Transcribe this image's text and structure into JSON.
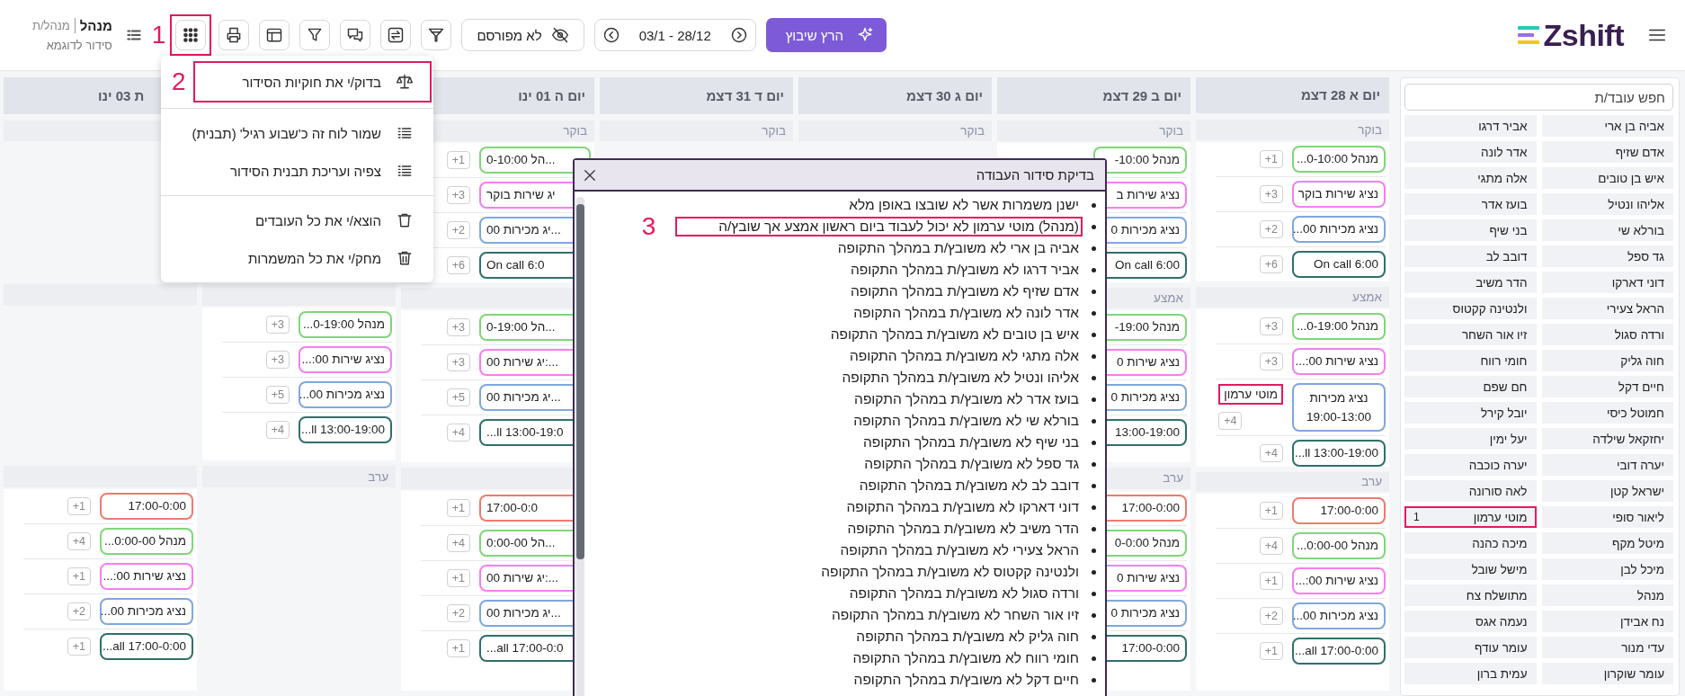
{
  "topbar": {
    "user": {
      "name": "מנהל",
      "role": "מנהל/ת",
      "schedule": "סידור לדוגמא"
    },
    "tools": [
      {
        "kind": "grid",
        "annotation": "1"
      },
      {
        "kind": "print"
      },
      {
        "kind": "layout"
      },
      {
        "kind": "filter"
      },
      {
        "kind": "chat"
      },
      {
        "kind": "swap"
      },
      {
        "kind": "funnel"
      }
    ],
    "publish": "לא מפורסם",
    "date_range": "03/1 - 28/12",
    "run_button": "הרץ שיבוץ",
    "logo": "Zshift"
  },
  "days": [
    {
      "header": {
        "text": "יום א 28 דצמ"
      },
      "morning": {
        "label": "בוקר",
        "shifts": [
          {
            "text": "מנהל 0-10:00...",
            "color": "#7fd67a",
            "count": "+1"
          },
          {
            "text": "נציג שירות בוקר",
            "color": "#f57ef0",
            "count": "+3"
          },
          {
            "text": "נציג מכירות 00...",
            "color": "#7fa7de",
            "count": "+2"
          },
          {
            "text": "On call 6:00",
            "color": "#2f6f6b",
            "count": "+6"
          }
        ]
      },
      "middle": {
        "label": "אמצע",
        "shifts": [
          {
            "text": "מנהל 0-19:00...",
            "color": "#7fd67a",
            "count": "+3"
          },
          {
            "text": "נציג שירות 00:...",
            "color": "#f57ef0",
            "count": "+3"
          },
          {
            "text": "נציג מכירות",
            "subtext": "19:00-13:00",
            "color": "#7fa7de",
            "count": "+4",
            "assigned": {
              "name": "מוטי ערמון",
              "highlighted": true
            }
          },
          {
            "text": "13:00-19:00 ll...",
            "color": "#2f6f6b",
            "count": "+4"
          }
        ]
      },
      "evening": {
        "label": "ערב",
        "shifts": [
          {
            "text": "17:00-0:00",
            "color": "#f07a6e",
            "count": "+1"
          },
          {
            "text": "מנהל 0:00-00...",
            "color": "#7fd67a",
            "count": "+4"
          },
          {
            "text": "נציג שירות 00:...",
            "color": "#f57ef0",
            "count": "+1"
          },
          {
            "text": "נציג מכירות 00...",
            "color": "#7fa7de",
            "count": "+2"
          },
          {
            "text": "17:00-0:00 all...",
            "color": "#2f6f6b",
            "count": "+1"
          }
        ]
      }
    },
    {
      "header": {
        "text": "יום ב 29 דצמ"
      },
      "morning": {
        "label": "בוקר",
        "shifts": [
          {
            "text": "מנהל 10:00-",
            "color": "#7fd67a"
          },
          {
            "text": "נציג שירות ב",
            "color": "#f57ef0"
          },
          {
            "text": "נציג מכירות 0",
            "color": "#7fa7de"
          },
          {
            "text": "On call 6:00",
            "color": "#2f6f6b"
          }
        ]
      },
      "middle": {
        "label": "אמצע",
        "shifts": [
          {
            "text": "מנהל 19:00-",
            "color": "#7fd67a"
          },
          {
            "text": "נציג שירות 0",
            "color": "#f57ef0"
          },
          {
            "text": "נציג מכירות 0",
            "color": "#7fa7de"
          },
          {
            "text": "13:00-19:00",
            "color": "#2f6f6b"
          }
        ]
      },
      "evening": {
        "label": "ערב",
        "shifts": [
          {
            "text": "17:00-0:00",
            "color": "#f07a6e"
          },
          {
            "text": "מנהל 0-0:00",
            "color": "#7fd67a"
          },
          {
            "text": "נציג שירות 0",
            "color": "#f57ef0"
          },
          {
            "text": "נציג מכירות 0",
            "color": "#7fa7de"
          },
          {
            "text": "17:00-0:00",
            "color": "#2f6f6b"
          }
        ]
      }
    },
    {
      "header": {
        "text": "יום ג 30 דצמ"
      },
      "morning": {
        "label": "בוקר"
      }
    },
    {
      "header": {
        "text": "יום ד 31 דצמ"
      },
      "morning": {
        "label": "בוקר"
      }
    },
    {
      "header": {
        "text": "יום ה 01 ינו"
      },
      "morning": {
        "label": "בוקר",
        "overlapped": true,
        "shifts": [
          {
            "text": "הל 0-10:00...",
            "color": "#7fd67a",
            "count": "+1"
          },
          {
            "text": "יג שירות בוקר",
            "color": "#f57ef0",
            "count": "+3"
          },
          {
            "text": "יג מכירות 00...",
            "color": "#7fa7de",
            "count": "+2"
          },
          {
            "text": "On call 6:0",
            "color": "#2f6f6b",
            "count": "+6"
          }
        ]
      },
      "middle": {
        "overlapped": true,
        "shifts": [
          {
            "text": "הל 0-19:00...",
            "color": "#7fd67a",
            "count": "+3"
          },
          {
            "text": "יג שירות 00:...",
            "color": "#f57ef0",
            "count": "+3"
          },
          {
            "text": "יג מכירות 00...",
            "color": "#7fa7de",
            "count": "+5"
          },
          {
            "text": "...ll 13:00-19:0",
            "color": "#2f6f6b",
            "count": "+4"
          }
        ]
      },
      "evening": {
        "overlapped": true,
        "shifts": [
          {
            "text": "17:00-0:0",
            "color": "#f07a6e",
            "count": "+1"
          },
          {
            "text": "הל 0:00-00...",
            "color": "#7fd67a",
            "count": "+4"
          },
          {
            "text": "יג שירות 00:...",
            "color": "#f57ef0",
            "count": "+1"
          },
          {
            "text": "יג מכירות 00...",
            "color": "#7fa7de",
            "count": "+2"
          },
          {
            "text": "...all 17:00-0:0",
            "color": "#2f6f6b",
            "count": "+1"
          }
        ]
      }
    },
    {
      "middle": {
        "shifts": [
          {
            "text": "מנהל 0-19:00...",
            "color": "#7fd67a",
            "count": "+3"
          },
          {
            "text": "נציג שירות 00:...",
            "color": "#f57ef0",
            "count": "+3"
          },
          {
            "text": "נציג מכירות 00...",
            "color": "#7fa7de",
            "count": "+5"
          },
          {
            "text": "13:00-19:00 ll...",
            "color": "#2f6f6b",
            "count": "+4"
          }
        ]
      },
      "evening": {
        "label": "ערב"
      }
    },
    {
      "header": {
        "text": "ת 03 ינו",
        "overlapped": true
      },
      "evening": {
        "shifts": [
          {
            "text": "17:00-0:00",
            "color": "#f07a6e",
            "count": "+1"
          },
          {
            "text": "מנהל 0:00-00...",
            "color": "#7fd67a",
            "count": "+4"
          },
          {
            "text": "נציג שירות 00:...",
            "color": "#f57ef0",
            "count": "+1"
          },
          {
            "text": "נציג מכירות 00...",
            "color": "#7fa7de",
            "count": "+2"
          },
          {
            "text": "17:00-0:00 all...",
            "color": "#2f6f6b",
            "count": "+1"
          }
        ]
      }
    }
  ],
  "sidebar": {
    "search_placeholder": "חפש עובד/ת",
    "employees": [
      {
        "name": "אביה בן ארי",
        "highlighted": false
      },
      {
        "name": "אביר דרגו",
        "highlighted": false
      },
      {
        "name": "אדם שזיף",
        "highlighted": false
      },
      {
        "name": "אדר לונה",
        "highlighted": false
      },
      {
        "name": "איש בן טובים",
        "highlighted": false
      },
      {
        "name": "אלה מתגי",
        "highlighted": false
      },
      {
        "name": "אליהו ונטיל",
        "highlighted": false
      },
      {
        "name": "בועז אדר",
        "highlighted": false
      },
      {
        "name": "בורלא שי",
        "highlighted": false
      },
      {
        "name": "בני שיף",
        "highlighted": false
      },
      {
        "name": "גד ספל",
        "highlighted": false
      },
      {
        "name": "דובב לב",
        "highlighted": false
      },
      {
        "name": "דוני דארקו",
        "highlighted": false
      },
      {
        "name": "הדר משיב",
        "highlighted": false
      },
      {
        "name": "הראל צעירי",
        "highlighted": false
      },
      {
        "name": "ולנטינה קקטוס",
        "highlighted": false
      },
      {
        "name": "ורדה סגול",
        "highlighted": false
      },
      {
        "name": "זיו אור השחר",
        "highlighted": false
      },
      {
        "name": "חוה גליק",
        "highlighted": false
      },
      {
        "name": "חומי רווח",
        "highlighted": false
      },
      {
        "name": "חיים דקל",
        "highlighted": false
      },
      {
        "name": "חם שפם",
        "highlighted": false
      },
      {
        "name": "חמוטל כיסי",
        "highlighted": false
      },
      {
        "name": "יובל קירל",
        "highlighted": false
      },
      {
        "name": "יחזקאל שילדה",
        "highlighted": false
      },
      {
        "name": "יעל ימין",
        "highlighted": false
      },
      {
        "name": "יערה דובי",
        "highlighted": false
      },
      {
        "name": "יערה כוכבה",
        "highlighted": false
      },
      {
        "name": "ישראל קטן",
        "highlighted": false
      },
      {
        "name": "לאה סורונה",
        "highlighted": false
      },
      {
        "name": "ליאור סופי",
        "highlighted": false
      },
      {
        "name": "מוטי ערמון",
        "count": "1",
        "highlighted": true
      },
      {
        "name": "מיטל מקף",
        "highlighted": false
      },
      {
        "name": "מיכה כהנה",
        "highlighted": false
      },
      {
        "name": "מיכל לבן",
        "highlighted": false
      },
      {
        "name": "מישל שובל",
        "highlighted": false
      },
      {
        "name": "מנהל",
        "highlighted": false
      },
      {
        "name": "מתושלח צח",
        "highlighted": false
      },
      {
        "name": "נח אבידן",
        "highlighted": false
      },
      {
        "name": "נעמה אגס",
        "highlighted": false
      },
      {
        "name": "עדי מנור",
        "highlighted": false
      },
      {
        "name": "עומר עודף",
        "highlighted": false
      },
      {
        "name": "עומר שוקרון",
        "highlighted": false
      },
      {
        "name": "עמית ברון",
        "highlighted": false
      }
    ]
  },
  "menu": {
    "groups": [
      [
        {
          "kind": "rules",
          "label": "בדוק/י את חוקיות הסידור",
          "highlighted": true,
          "marker": "2"
        }
      ],
      [
        {
          "kind": "save-template",
          "label": "שמור לוח זה כ'שבוע רגיל' (תבנית)",
          "highlighted": false
        },
        {
          "kind": "view-template",
          "label": "צפיה ועריכת תבנית הסידור",
          "highlighted": false
        }
      ],
      [
        {
          "kind": "remove-employees",
          "label": "הוצא/י את כל העובדים",
          "highlighted": false
        },
        {
          "kind": "delete-shifts",
          "label": "מחק/י את כל המשמרות",
          "highlighted": false
        }
      ]
    ]
  },
  "dialog": {
    "title": "בדיקת סידור העבודה",
    "items": [
      {
        "text": "ישנן משמרות אשר לא שובצו באופן מלא",
        "highlighted": false
      },
      {
        "text": "(מנהל) מוטי ערמון לא יכול לעבוד ביום ראשון אמצע אך שובץ/ה",
        "highlighted": true,
        "marker": "3"
      },
      {
        "text": "אביה בן ארי לא משובץ/ת במהלך התקופה",
        "highlighted": false
      },
      {
        "text": "אביר דרגו לא משובץ/ת במהלך התקופה",
        "highlighted": false
      },
      {
        "text": "אדם שזיף לא משובץ/ת במהלך התקופה",
        "highlighted": false
      },
      {
        "text": "אדר לונה לא משובץ/ת במהלך התקופה",
        "highlighted": false
      },
      {
        "text": "איש בן טובים לא משובץ/ת במהלך התקופה",
        "highlighted": false
      },
      {
        "text": "אלה מתגי לא משובץ/ת במהלך התקופה",
        "highlighted": false
      },
      {
        "text": "אליהו ונטיל לא משובץ/ת במהלך התקופה",
        "highlighted": false
      },
      {
        "text": "בועז אדר לא משובץ/ת במהלך התקופה",
        "highlighted": false
      },
      {
        "text": "בורלא שי לא משובץ/ת במהלך התקופה",
        "highlighted": false
      },
      {
        "text": "בני שיף לא משובץ/ת במהלך התקופה",
        "highlighted": false
      },
      {
        "text": "גד ספל לא משובץ/ת במהלך התקופה",
        "highlighted": false
      },
      {
        "text": "דובב לב לא משובץ/ת במהלך התקופה",
        "highlighted": false
      },
      {
        "text": "דוני דארקו לא משובץ/ת במהלך התקופה",
        "highlighted": false
      },
      {
        "text": "הדר משיב לא משובץ/ת במהלך התקופה",
        "highlighted": false
      },
      {
        "text": "הראל צעירי לא משובץ/ת במהלך התקופה",
        "highlighted": false
      },
      {
        "text": "ולנטינה קקטוס לא משובץ/ת במהלך התקופה",
        "highlighted": false
      },
      {
        "text": "ורדה סגול לא משובץ/ת במהלך התקופה",
        "highlighted": false
      },
      {
        "text": "זיו אור השחר לא משובץ/ת במהלך התקופה",
        "highlighted": false
      },
      {
        "text": "חוה גליק לא משובץ/ת במהלך התקופה",
        "highlighted": false
      },
      {
        "text": "חומי רווח לא משובץ/ת במהלך התקופה",
        "highlighted": false
      },
      {
        "text": "חיים דקל לא משובץ/ת במהלך התקופה",
        "highlighted": false
      }
    ]
  }
}
